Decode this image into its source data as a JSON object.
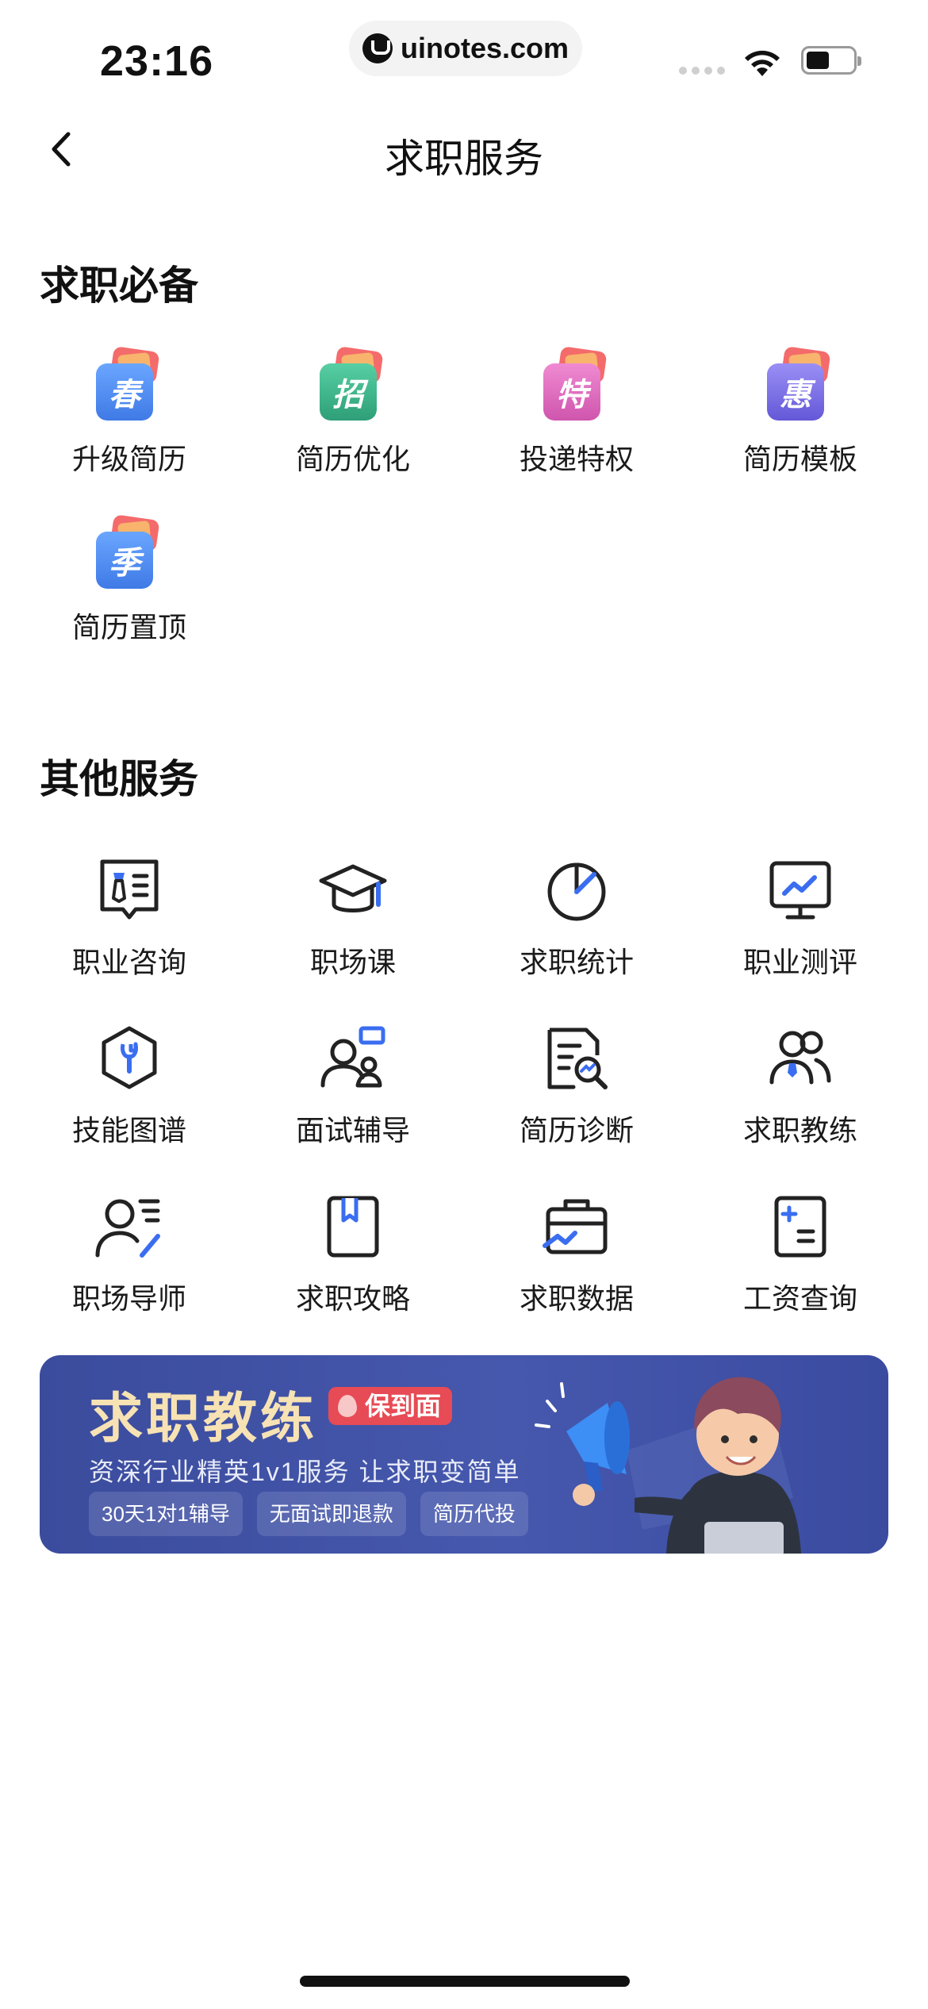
{
  "status_bar": {
    "time": "23:16",
    "watermark": "uinotes.com"
  },
  "nav": {
    "title": "求职服务"
  },
  "section1": {
    "title": "求职必备",
    "items": [
      {
        "label": "升级简历",
        "badge": "春",
        "color": "#4f8df0"
      },
      {
        "label": "简历优化",
        "badge": "招",
        "color": "#3db58b"
      },
      {
        "label": "投递特权",
        "badge": "特",
        "color": "#e26bbf"
      },
      {
        "label": "简历模板",
        "badge": "惠",
        "color": "#7d72e6"
      },
      {
        "label": "简历置顶",
        "badge": "季",
        "color": "#4f8df0"
      }
    ]
  },
  "section2": {
    "title": "其他服务",
    "items": [
      {
        "label": "职业咨询",
        "icon": "consult-icon"
      },
      {
        "label": "职场课",
        "icon": "graduation-cap-icon"
      },
      {
        "label": "求职统计",
        "icon": "pie-chart-icon"
      },
      {
        "label": "职业测评",
        "icon": "monitor-chart-icon"
      },
      {
        "label": "技能图谱",
        "icon": "hexagon-wrench-icon"
      },
      {
        "label": "面试辅导",
        "icon": "interview-icon"
      },
      {
        "label": "简历诊断",
        "icon": "document-search-icon"
      },
      {
        "label": "求职教练",
        "icon": "coach-icon"
      },
      {
        "label": "职场导师",
        "icon": "mentor-icon"
      },
      {
        "label": "求职攻略",
        "icon": "bookmark-book-icon"
      },
      {
        "label": "求职数据",
        "icon": "briefcase-chart-icon"
      },
      {
        "label": "工资查询",
        "icon": "calculator-icon"
      }
    ]
  },
  "banner": {
    "title": "求职教练",
    "tag": "保到面",
    "subtitle": "资深行业精英1v1服务 让求职变简单",
    "chips": [
      "30天1对1辅导",
      "无面试即退款",
      "简历代投"
    ]
  },
  "colors": {
    "accent": "#3a6df0",
    "banner_bg": "#4254a8",
    "banner_title": "#f7e2b4",
    "tag_red": "#e74b55"
  }
}
